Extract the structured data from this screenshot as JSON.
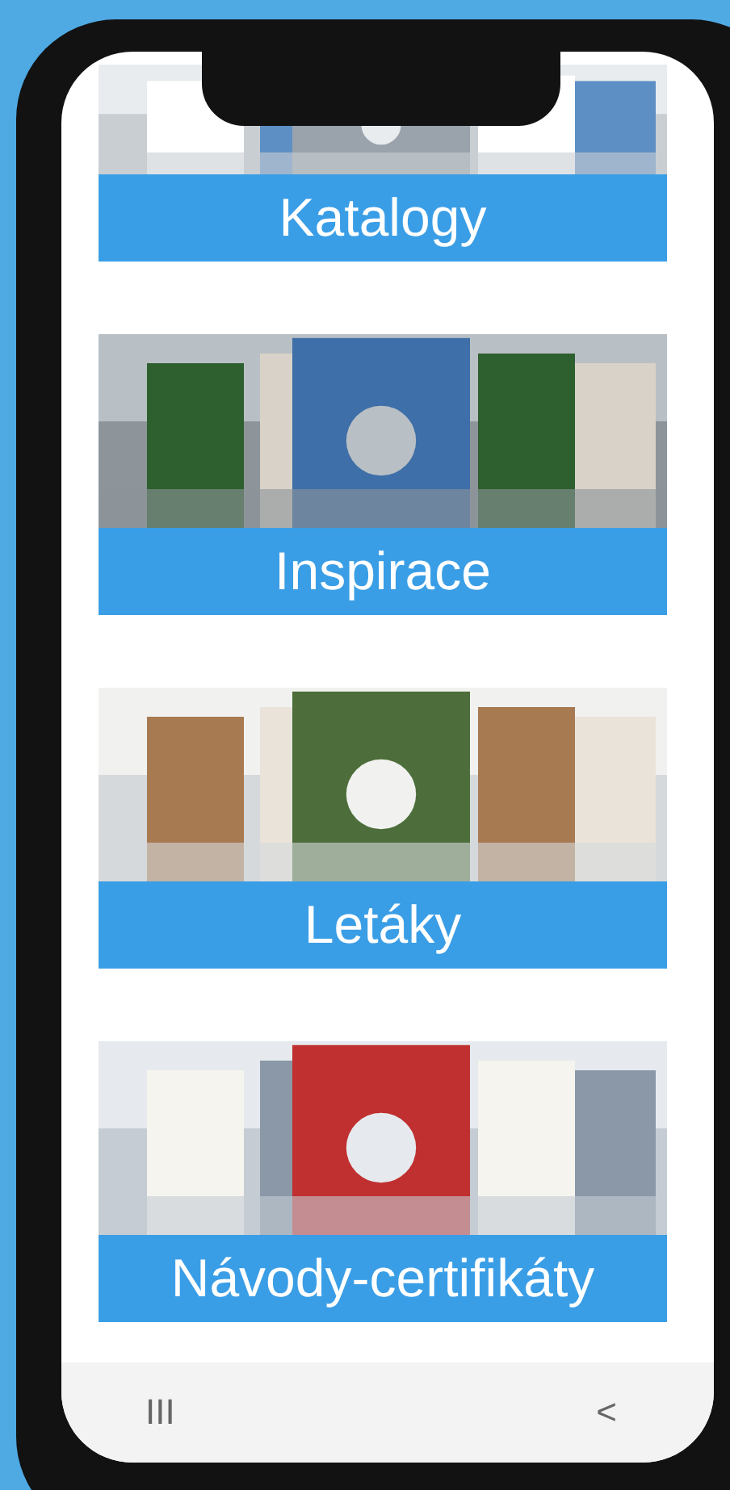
{
  "cards": [
    {
      "label": "Katalogy"
    },
    {
      "label": "Inspirace"
    },
    {
      "label": "Letáky"
    },
    {
      "label": "Návody-certifikáty"
    }
  ],
  "nav_bar": {
    "buttons": [
      {
        "label": "III"
      },
      {
        "label": "<"
      }
    ]
  }
}
